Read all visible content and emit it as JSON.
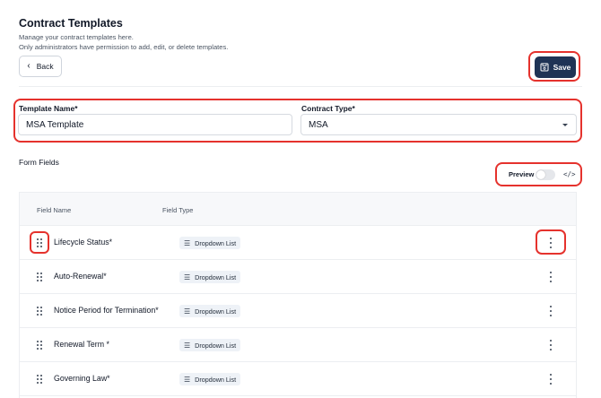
{
  "header": {
    "title": "Contract Templates",
    "subtitle_line1": "Manage your contract templates here.",
    "subtitle_line2": "Only administrators have permission to add, edit, or delete templates."
  },
  "toolbar": {
    "back_label": "Back",
    "save_label": "Save"
  },
  "form": {
    "template_name_label": "Template Name*",
    "template_name_value": "MSA Template",
    "contract_type_label": "Contract Type*",
    "contract_type_value": "MSA"
  },
  "form_fields": {
    "section_title": "Form Fields",
    "preview_label": "Preview",
    "preview_enabled": false,
    "code_icon": "code-icon"
  },
  "table": {
    "columns": [
      "Field Name",
      "Field Type"
    ],
    "rows": [
      {
        "name": "Lifecycle Status*",
        "type": "Dropdown List"
      },
      {
        "name": "Auto-Renewal*",
        "type": "Dropdown List"
      },
      {
        "name": "Notice Period for Termination*",
        "type": "Dropdown List"
      },
      {
        "name": "Renewal Term *",
        "type": "Dropdown List"
      },
      {
        "name": "Governing Law*",
        "type": "Dropdown List"
      }
    ]
  },
  "colors": {
    "primary": "#1f3355",
    "highlight": "#e5322d"
  }
}
